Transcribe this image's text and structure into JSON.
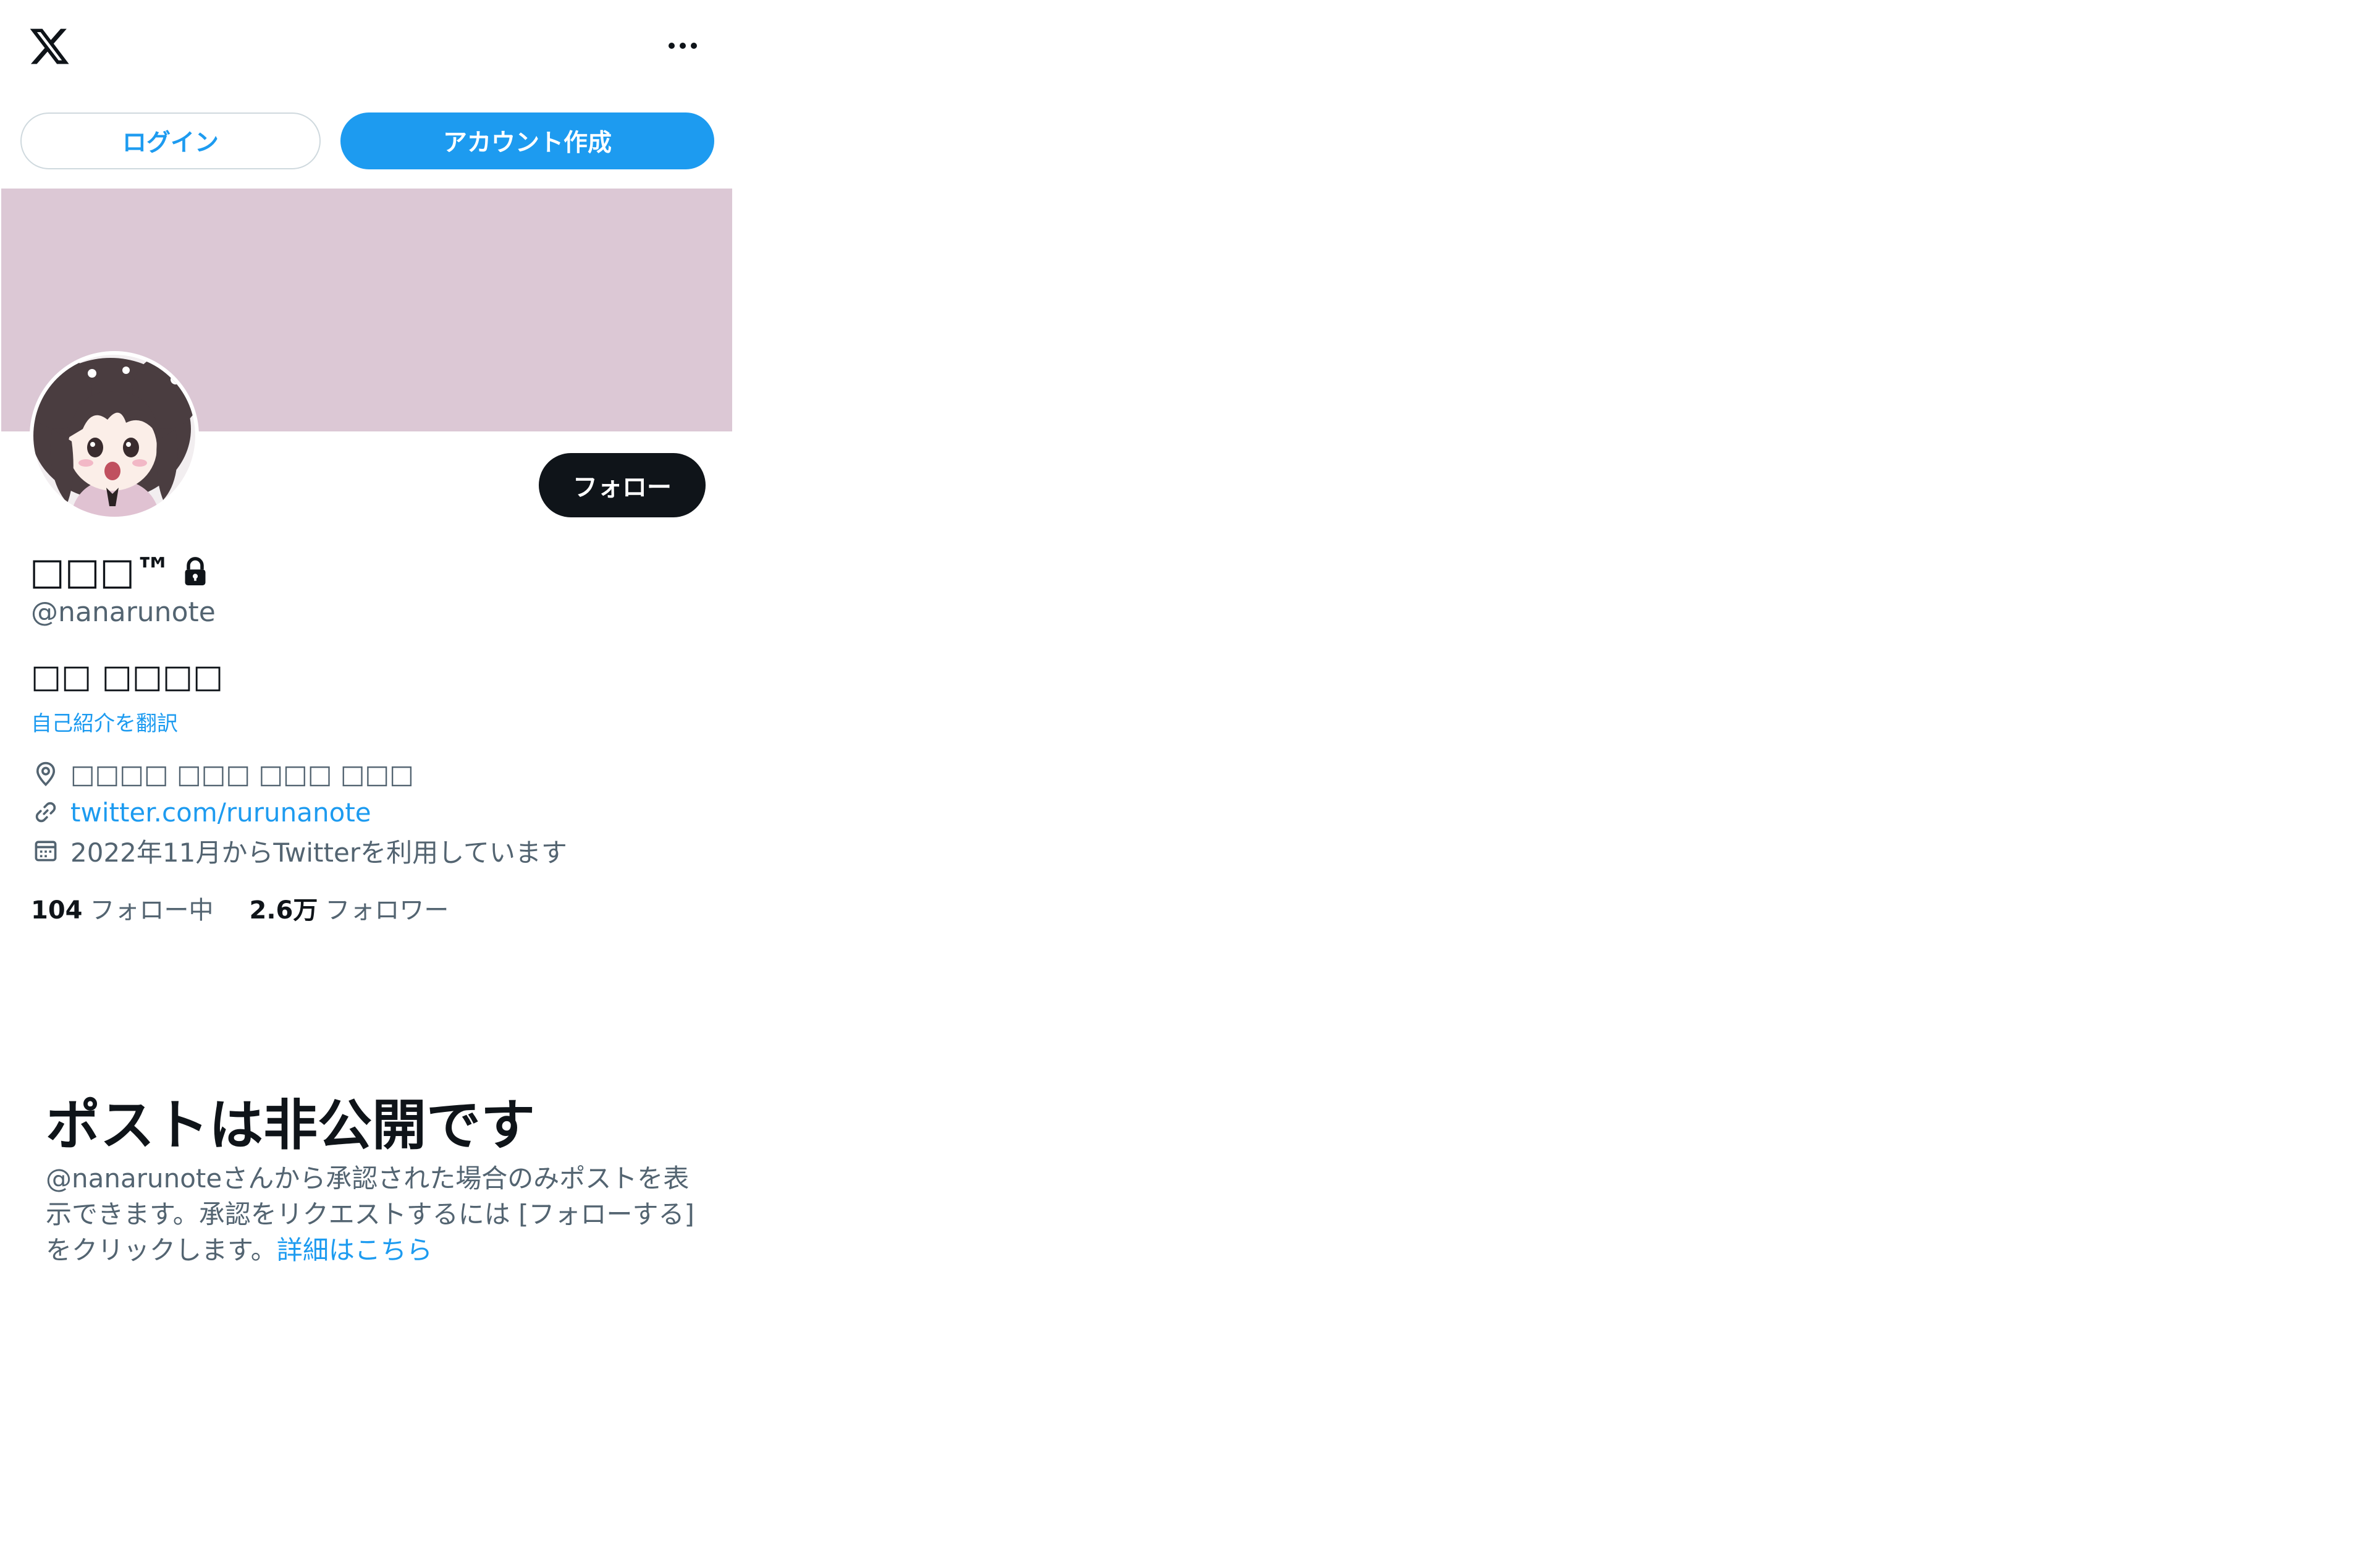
{
  "header": {
    "logo_icon": "x-logo-icon",
    "more_icon": "more-horizontal-icon"
  },
  "auth": {
    "login_label": "ログイン",
    "signup_label": "アカウント作成"
  },
  "profile": {
    "banner_color": "#dcc8d5",
    "display_name": "□□□™",
    "handle": "@nanarunote",
    "follow_label": "フォロー",
    "bio": "□□ □□□□",
    "translate_label": "自己紹介を翻訳",
    "location": "□□□□ □□□ □□□ □□□",
    "url": "twitter.com/rurunanote",
    "joined": "2022年11月からTwitterを利用しています",
    "following_count": "104",
    "following_label": "フォロー中",
    "followers_count": "2.6万",
    "followers_label": "フォロワー"
  },
  "protected": {
    "title": "ポストは非公開です",
    "body": "@nanarunoteさんから承認された場合のみポストを表示できます。承認をリクエストするには [フォローする] をクリックします。",
    "link_label": "詳細はこちら"
  },
  "colors": {
    "accent": "#1d9bf0",
    "text_primary": "#0f1419",
    "text_secondary": "#536471"
  }
}
